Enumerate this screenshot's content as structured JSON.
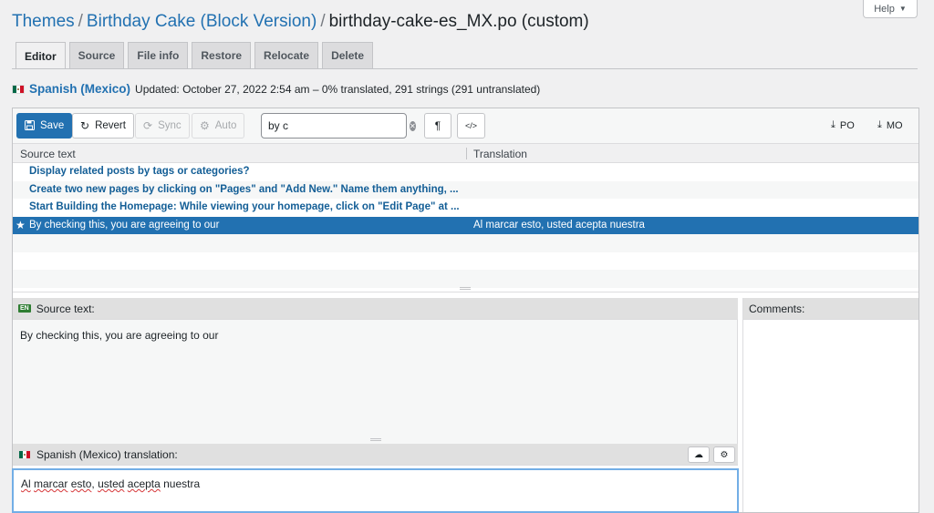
{
  "help": {
    "label": "Help"
  },
  "breadcrumb": {
    "themes": "Themes",
    "theme": "Birthday Cake (Block Version)",
    "file": "birthday-cake-es_MX.po (custom)"
  },
  "tabs": [
    {
      "label": "Editor"
    },
    {
      "label": "Source"
    },
    {
      "label": "File info"
    },
    {
      "label": "Restore"
    },
    {
      "label": "Relocate"
    },
    {
      "label": "Delete"
    }
  ],
  "language": {
    "name": "Spanish (Mexico)",
    "status": "Updated: October 27, 2022 2:54 am – 0% translated, 291 strings (291 untranslated)"
  },
  "toolbar": {
    "save": "Save",
    "revert": "Revert",
    "sync": "Sync",
    "auto": "Auto",
    "search_value": "by c",
    "po": "PO",
    "mo": "MO"
  },
  "grid": {
    "col_source": "Source text",
    "col_translation": "Translation",
    "rows": [
      {
        "source": "Display related posts by tags or categories?",
        "translation": ""
      },
      {
        "source": "Create two new pages by clicking on \"Pages\" and \"Add New.\" Name them anything, ...",
        "translation": ""
      },
      {
        "source": "Start Building the Homepage: While viewing your homepage, click on \"Edit Page\" at ...",
        "translation": ""
      },
      {
        "source": "By checking this, you are agreeing to our",
        "translation": "Al marcar esto, usted acepta nuestra"
      }
    ]
  },
  "source_panel": {
    "badge": "EN",
    "heading": "Source text:",
    "text": "By checking this, you are agreeing to our"
  },
  "translation_panel": {
    "heading": "Spanish (Mexico) translation:",
    "words": [
      "Al",
      " ",
      "marcar",
      " ",
      "esto",
      ", ",
      "usted",
      " ",
      "acepta",
      " nuestra"
    ]
  },
  "comments_panel": {
    "heading": "Comments:"
  },
  "colors": {
    "accent": "#2271b1",
    "selected_row": "#2271b1",
    "link": "#2271b1"
  }
}
